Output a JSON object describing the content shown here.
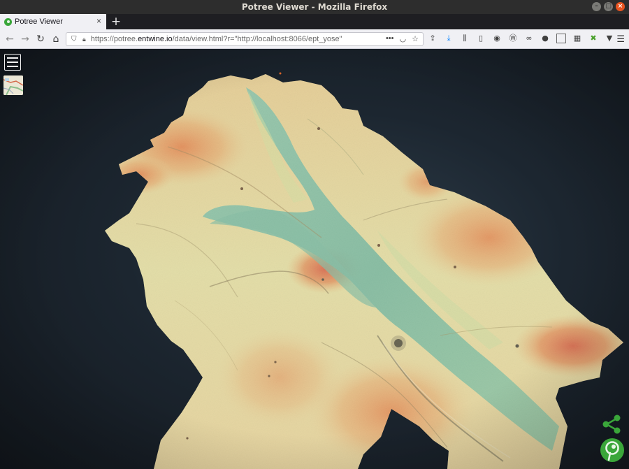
{
  "window": {
    "title": "Potree Viewer - Mozilla Firefox"
  },
  "tabs": [
    {
      "label": "Potree Viewer"
    }
  ],
  "navbar": {
    "url_prefix": "https://potree.",
    "url_domain": "entwine.io",
    "url_rest": "/data/view.html?r=\"http://localhost:8066/ept_yose\""
  },
  "viewer": {
    "menu_icon": "hamburger-menu-icon",
    "minimap_icon": "map-thumbnail-icon",
    "share_icon": "share-icon",
    "logo_icon": "potree-logo-icon"
  },
  "colors": {
    "low": "#5fb7a8",
    "mid": "#dfe09a",
    "high": "#e4562f",
    "brand": "#3aa63a",
    "background": "#171d24"
  }
}
